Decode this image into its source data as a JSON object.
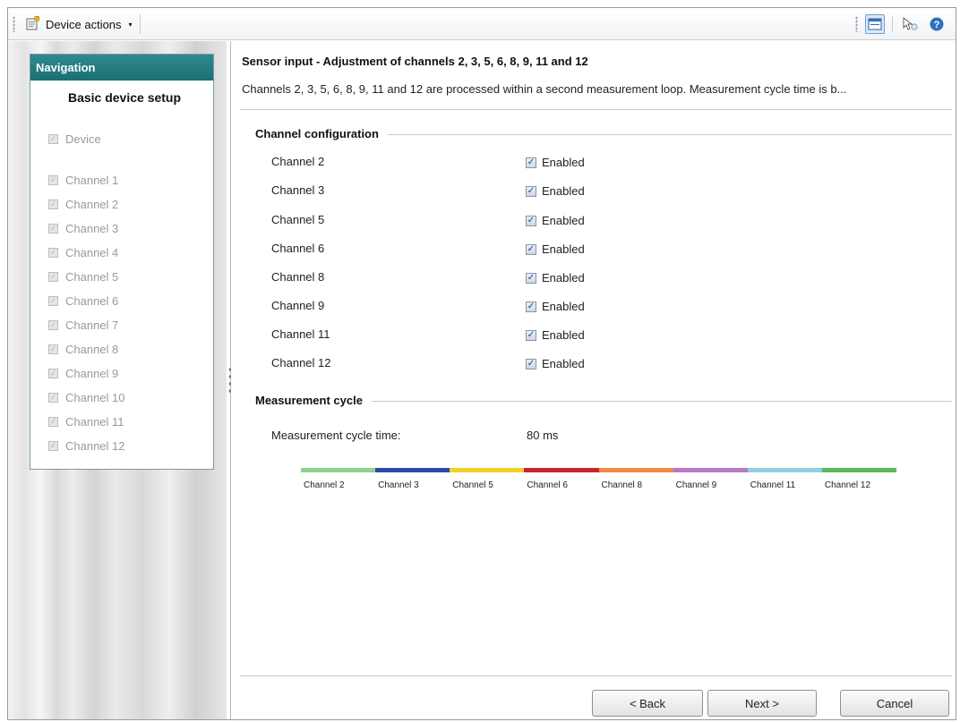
{
  "toolbar": {
    "device_actions_label": "Device actions",
    "dropdown_arrow": "▾",
    "help_glyph": "?"
  },
  "navigation": {
    "header": "Navigation",
    "title": "Basic device setup",
    "device_item": "Device",
    "channel_items": [
      "Channel 1",
      "Channel 2",
      "Channel 3",
      "Channel 4",
      "Channel 5",
      "Channel 6",
      "Channel 7",
      "Channel 8",
      "Channel 9",
      "Channel 10",
      "Channel 11",
      "Channel 12"
    ]
  },
  "main": {
    "title": "Sensor input - Adjustment of channels 2, 3, 5, 6, 8, 9, 11 and 12",
    "description": "Channels 2, 3, 5, 6, 8, 9, 11 and 12 are processed within a second measurement loop. Measurement cycle time is b...",
    "channel_config_title": "Channel configuration",
    "channels": [
      {
        "label": "Channel 2",
        "checkbox_label": "Enabled",
        "checked": true
      },
      {
        "label": "Channel 3",
        "checkbox_label": "Enabled",
        "checked": true
      },
      {
        "label": "Channel 5",
        "checkbox_label": "Enabled",
        "checked": true
      },
      {
        "label": "Channel 6",
        "checkbox_label": "Enabled",
        "checked": true
      },
      {
        "label": "Channel 8",
        "checkbox_label": "Enabled",
        "checked": true
      },
      {
        "label": "Channel 9",
        "checkbox_label": "Enabled",
        "checked": true
      },
      {
        "label": "Channel 11",
        "checkbox_label": "Enabled",
        "checked": true
      },
      {
        "label": "Channel 12",
        "checkbox_label": "Enabled",
        "checked": true
      }
    ],
    "measurement_cycle_title": "Measurement cycle",
    "measurement_cycle_label": "Measurement cycle time:",
    "measurement_cycle_value": "80 ms",
    "cycle_segments": [
      {
        "label": "Channel 2",
        "color": "#8fd28f"
      },
      {
        "label": "Channel 3",
        "color": "#2a4aa8"
      },
      {
        "label": "Channel 5",
        "color": "#f2d22a"
      },
      {
        "label": "Channel 6",
        "color": "#c8262a"
      },
      {
        "label": "Channel 8",
        "color": "#ee8a44"
      },
      {
        "label": "Channel 9",
        "color": "#b879c6"
      },
      {
        "label": "Channel 11",
        "color": "#8fd0e0"
      },
      {
        "label": "Channel 12",
        "color": "#5cb85c"
      }
    ]
  },
  "buttons": {
    "back": "< Back",
    "next": "Next >",
    "cancel": "Cancel"
  },
  "colors": {
    "nav_header": "#1f777a",
    "toolbar_accent": "#6d9fd3",
    "help_icon": "#2f6fbf"
  }
}
